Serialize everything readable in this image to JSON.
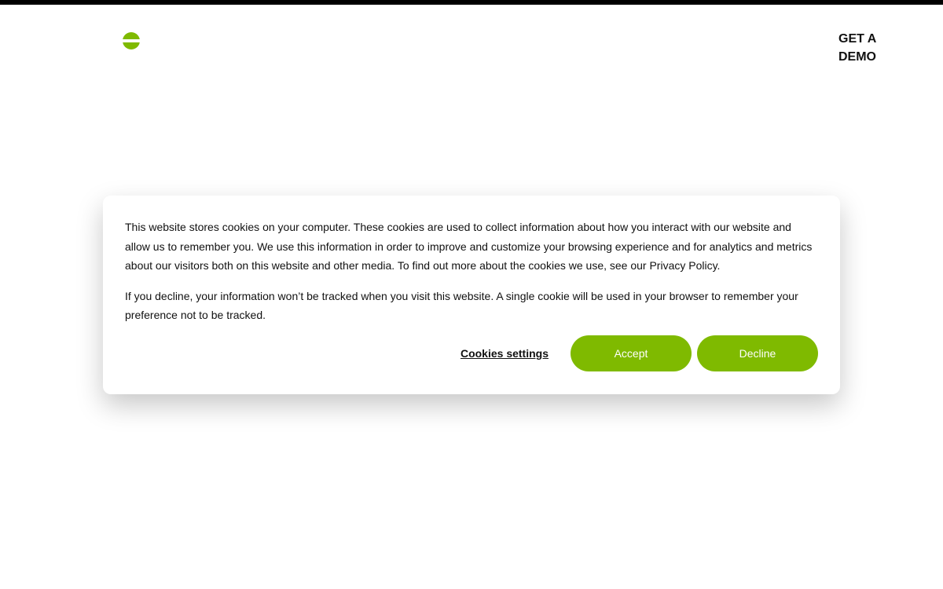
{
  "header": {
    "logo_icon": "green-circle-logo-icon",
    "demo_link_label": "GET A DEMO"
  },
  "colors": {
    "brand_green": "#7fba00",
    "top_bar": "#000000"
  },
  "cookie_banner": {
    "paragraph_1": "This website stores cookies on your computer. These cookies are used to collect information about how you interact with our website and allow us to remember you. We use this information in order to improve and customize your browsing experience and for analytics and metrics about our visitors both on this website and other media. To find out more about the cookies we use, see our Privacy Policy.",
    "paragraph_2": "If you decline, your information won’t be tracked when you visit this website. A single cookie will be used in your browser to remember your preference not to be tracked.",
    "settings_label": "Cookies settings",
    "accept_label": "Accept",
    "decline_label": "Decline"
  }
}
